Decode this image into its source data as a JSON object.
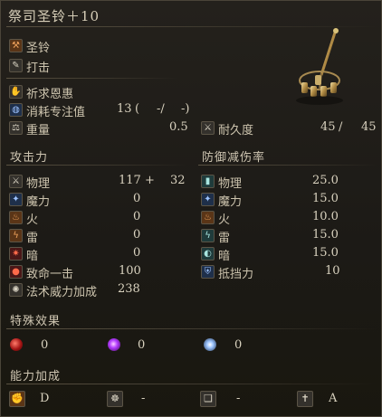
{
  "weapon": {
    "name": "祭司圣铃＋10",
    "type": "圣铃",
    "attack_type": "打击",
    "spell_type": "祈求恩惠",
    "fp_cost": {
      "label": "消耗专注值",
      "base": "13",
      "open": "(",
      "a": "-/",
      "b": "-)"
    },
    "weight": {
      "label": "重量",
      "value": "0.5"
    },
    "durability": {
      "label": "耐久度",
      "current": "45",
      "sep": "/",
      "max": "45"
    }
  },
  "attack": {
    "header": "攻击力",
    "rows": [
      {
        "label": "物理",
        "value": "117",
        "plus": "+",
        "bonus": "32"
      },
      {
        "label": "魔力",
        "value": "0"
      },
      {
        "label": "火",
        "value": "0"
      },
      {
        "label": "雷",
        "value": "0"
      },
      {
        "label": "暗",
        "value": "0"
      },
      {
        "label": "致命一击",
        "value": "100"
      },
      {
        "label": "法术威力加成",
        "value": "238"
      }
    ]
  },
  "defense": {
    "header": "防御减伤率",
    "rows": [
      {
        "label": "物理",
        "value": "25.0"
      },
      {
        "label": "魔力",
        "value": "15.0"
      },
      {
        "label": "火",
        "value": "10.0"
      },
      {
        "label": "雷",
        "value": "15.0"
      },
      {
        "label": "暗",
        "value": "15.0"
      },
      {
        "label": "抵挡力",
        "value": "10"
      }
    ]
  },
  "effects": {
    "header": "特殊效果",
    "items": [
      {
        "icon": "bleed-icon",
        "value": "0"
      },
      {
        "icon": "poison-icon",
        "value": "0"
      },
      {
        "icon": "frost-icon",
        "value": "0"
      }
    ]
  },
  "scaling": {
    "header": "能力加成",
    "items": [
      {
        "icon": "strength-icon",
        "value": "D"
      },
      {
        "icon": "dexterity-icon",
        "value": "-"
      },
      {
        "icon": "intelligence-icon",
        "value": "-"
      },
      {
        "icon": "faith-icon",
        "value": "A"
      }
    ]
  }
}
